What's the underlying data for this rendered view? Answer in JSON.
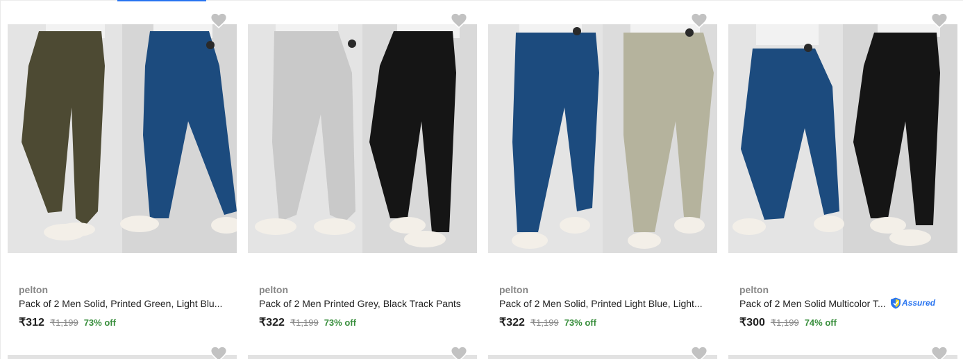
{
  "colors": {
    "accent": "#2874f0",
    "discount": "#388e3c",
    "muted": "#878787",
    "text": "#212121",
    "wishlist_heart": "#c2c2c2"
  },
  "products": [
    {
      "brand": "pelton",
      "title": "Pack of 2 Men Solid, Printed Green, Light Blu...",
      "price": "₹312",
      "mrp": "₹1,199",
      "discount": "73% off",
      "pant_colors": [
        "#4d4a33",
        "#1c4b7e"
      ],
      "wishlist_icon": "heart-icon"
    },
    {
      "brand": "pelton",
      "title": "Pack of 2 Men Printed Grey, Black Track Pants",
      "price": "₹322",
      "mrp": "₹1,199",
      "discount": "73% off",
      "pant_colors": [
        "#c9c9c9",
        "#151515"
      ],
      "wishlist_icon": "heart-icon"
    },
    {
      "brand": "pelton",
      "title": "Pack of 2 Men Solid, Printed Light Blue, Light...",
      "price": "₹322",
      "mrp": "₹1,199",
      "discount": "73% off",
      "pant_colors": [
        "#1c4b7e",
        "#b5b39d"
      ],
      "wishlist_icon": "heart-icon"
    },
    {
      "brand": "pelton",
      "title": "Pack of 2 Men Solid Multicolor T...",
      "price": "₹300",
      "mrp": "₹1,199",
      "discount": "74% off",
      "pant_colors": [
        "#1c4b7e",
        "#151515"
      ],
      "wishlist_icon": "heart-icon",
      "badge": "Assured"
    }
  ]
}
